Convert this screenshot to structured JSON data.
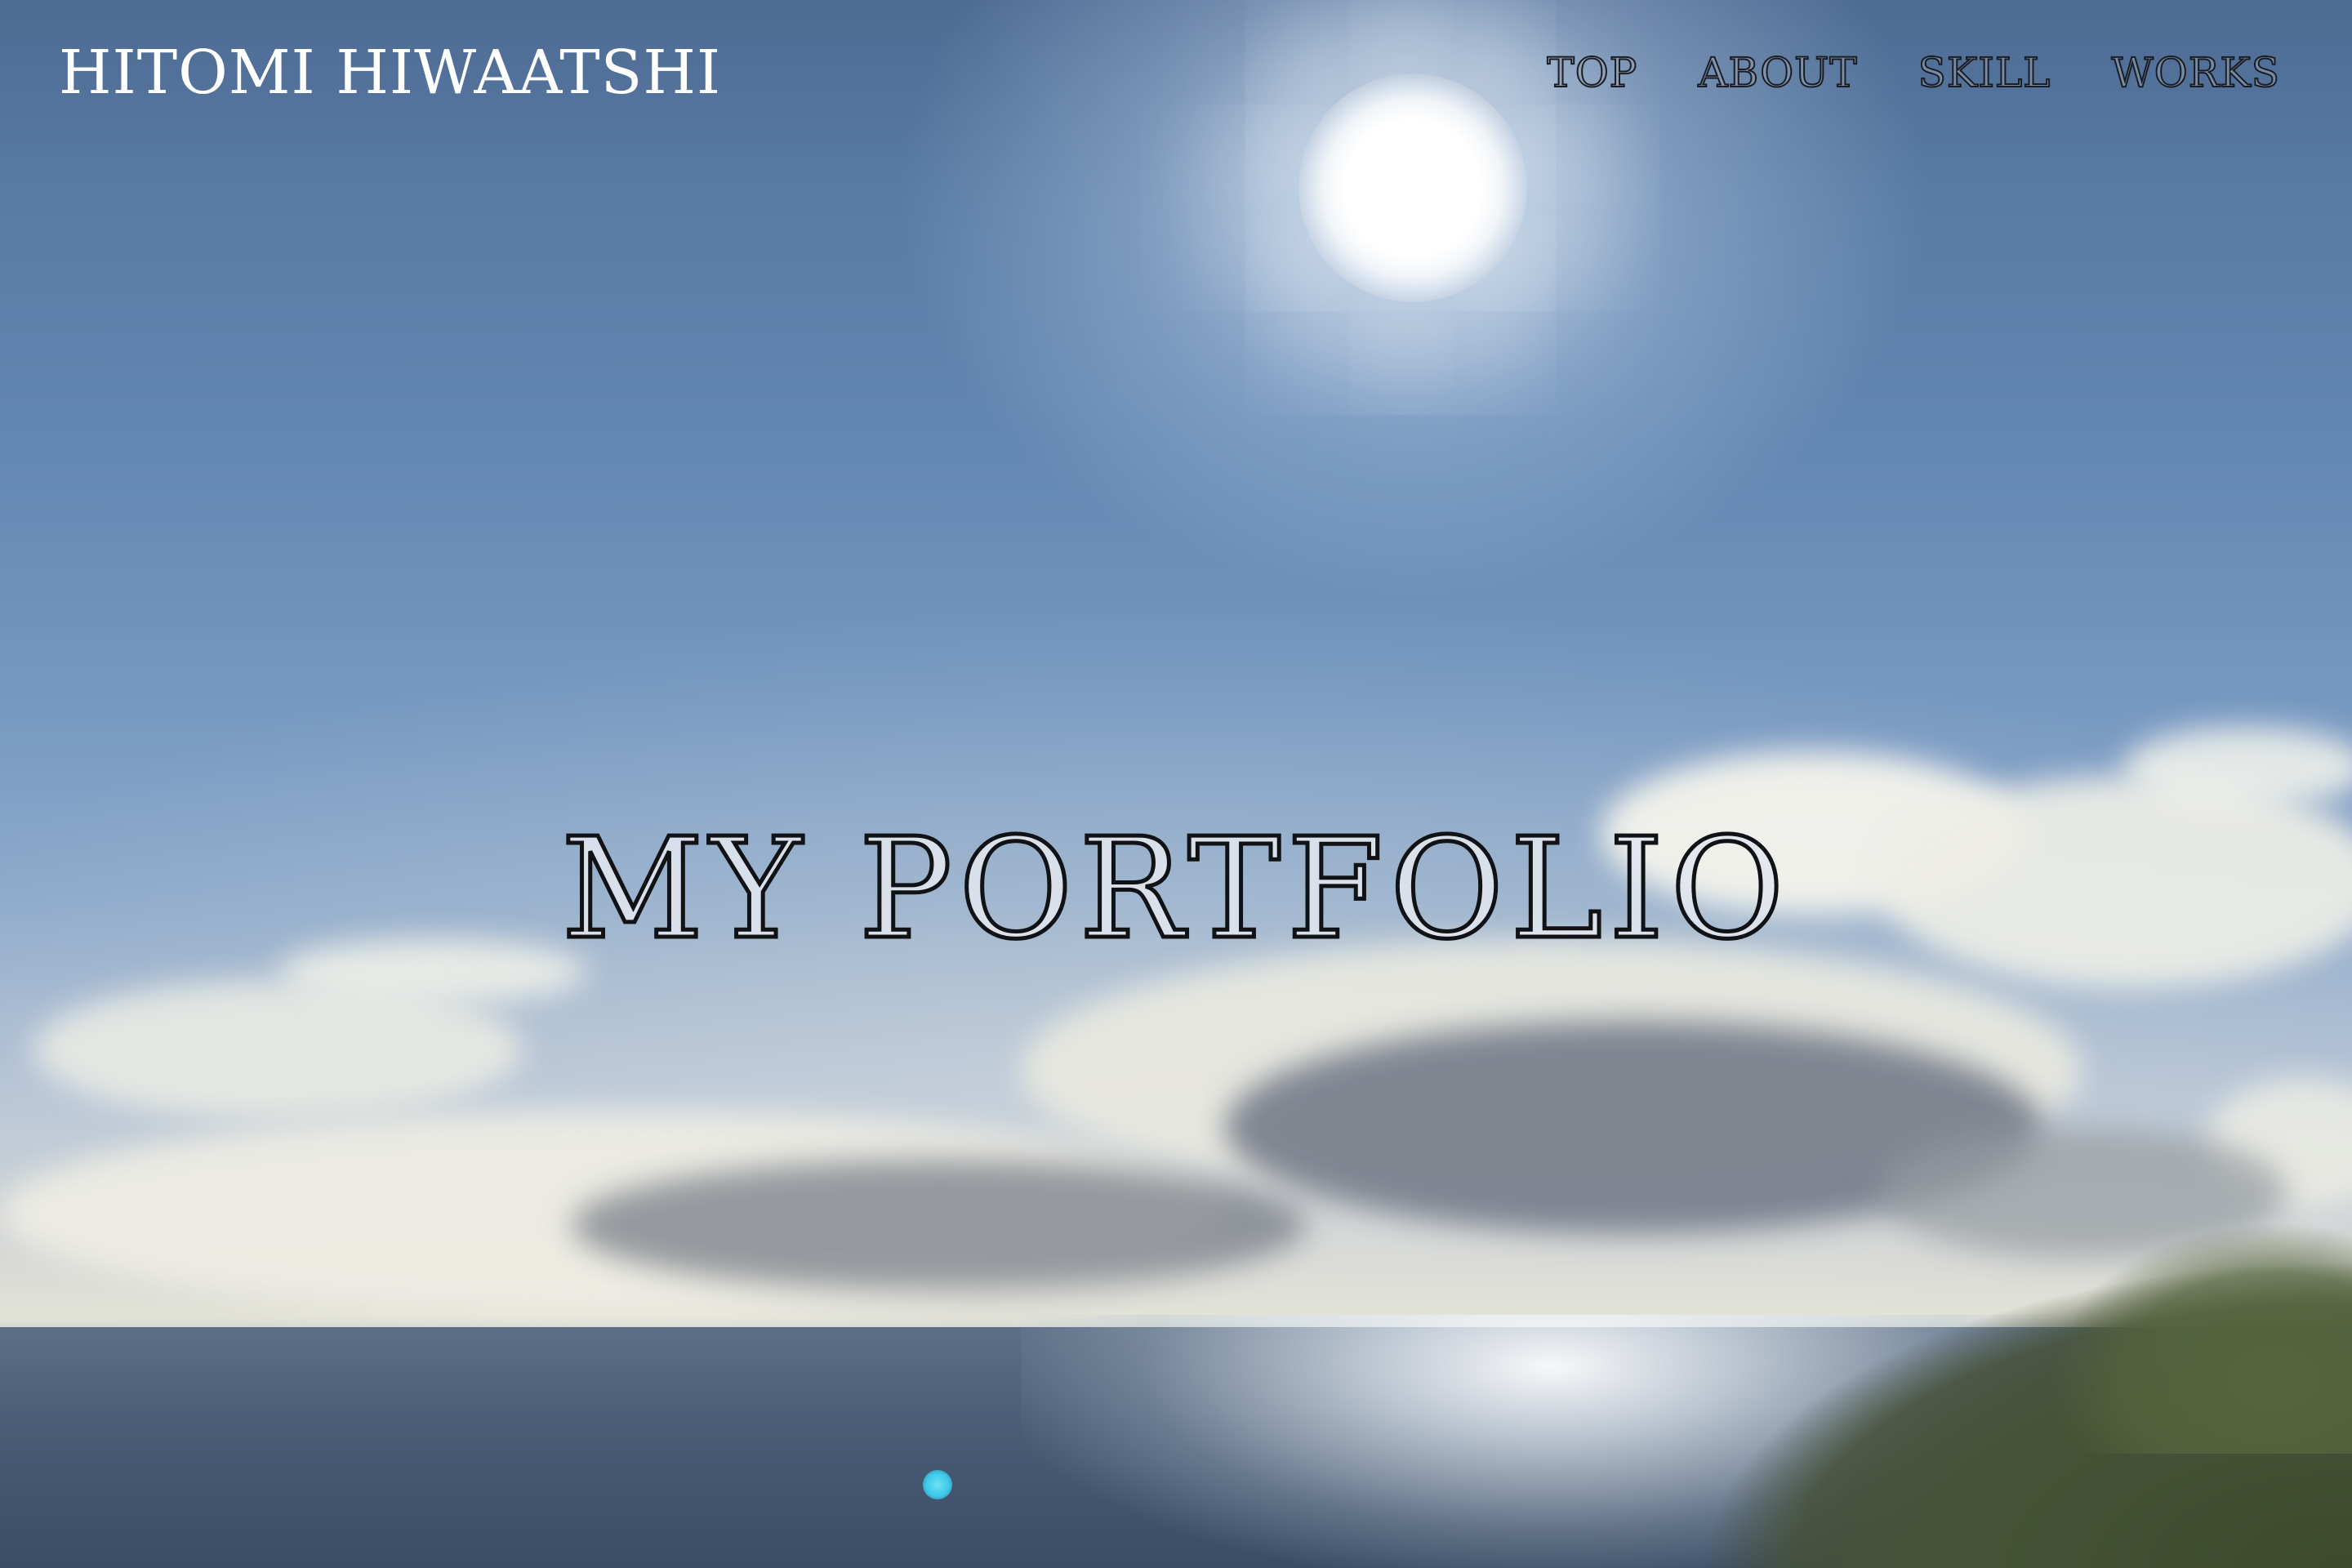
{
  "site": {
    "brand": "HITOMI HIWAATSHI"
  },
  "nav": {
    "items": [
      {
        "label": "TOP"
      },
      {
        "label": "ABOUT"
      },
      {
        "label": "SKILL"
      },
      {
        "label": "WORKS"
      }
    ]
  },
  "hero": {
    "title": "MY PORTFOLIO",
    "background": "seaside-sky-photo"
  },
  "colors": {
    "brand_text": "#ffffff",
    "title_outline": "#101215"
  }
}
